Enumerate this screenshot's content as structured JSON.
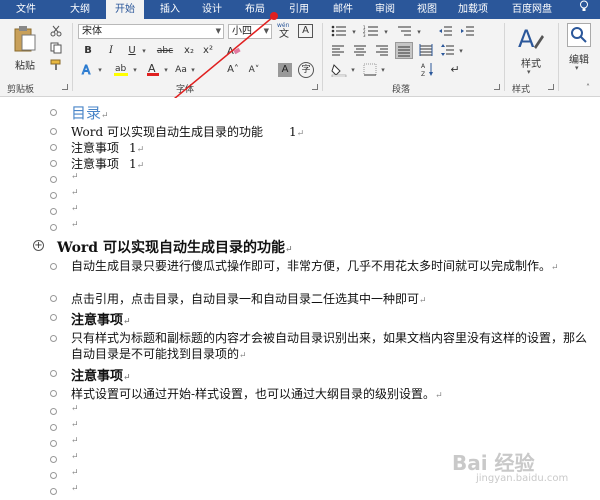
{
  "tabs": [
    "文件",
    "大纲",
    "开始",
    "插入",
    "设计",
    "布局",
    "引用",
    "邮件",
    "审阅",
    "视图",
    "加载项",
    "百度网盘"
  ],
  "active_tab": "开始",
  "ribbon": {
    "paste_label": "粘贴",
    "clipboard_label": "剪贴板",
    "font_label": "字体",
    "paragraph_label": "段落",
    "styles_group_label": "样式",
    "styles_button": "样式",
    "edit_button": "编辑",
    "font_name": "宋体",
    "font_size": "小四",
    "bold": "B",
    "italic": "I",
    "underline": "U",
    "strike": "abc",
    "subscript": "x₂",
    "superscript": "x²",
    "wen_icon_char": "文",
    "a_box": "A",
    "grow_font": "A˄",
    "shrink_font": "A˅",
    "char_shading": "A",
    "enclose_char": "字"
  },
  "colors": {
    "tab_bar": "#2b579a",
    "arrow": "#e02020",
    "toc_title": "#4a86c8",
    "highlight_yellow": "#ffff00",
    "font_color_red": "#e02020"
  },
  "document": {
    "toc_title": "目录",
    "toc_lines": [
      {
        "text": "Word 可以实现自动生成目录的功能",
        "page": "1"
      },
      {
        "text": "注意事项",
        "page": "1"
      },
      {
        "text": "注意事项",
        "page": "1"
      }
    ],
    "heading_main": "Word 可以实现自动生成目录的功能",
    "body": [
      "自动生成目录只要进行傻瓜式操作即可，非常方便，几乎不用花太多时间就可以完成制作。",
      "点击引用，点击目录，自动目录一和自动目录二任选其中一种即可"
    ],
    "heading_notes": "注意事项",
    "notes_body": "只有样式为标题和副标题的内容才会被自动目录识别出来，如果文档内容里没有这样的设置，那么自动目录是不可能找到目录项的",
    "heading_notes2": "注意事项",
    "notes2_body": "样式设置可以通过开始-样式设置，也可以通过大纲目录的级别设置。",
    "paragraph_mark": "↵"
  },
  "watermark": {
    "brand": "Bai 经验",
    "sub": "jingyan.baidu.com"
  }
}
